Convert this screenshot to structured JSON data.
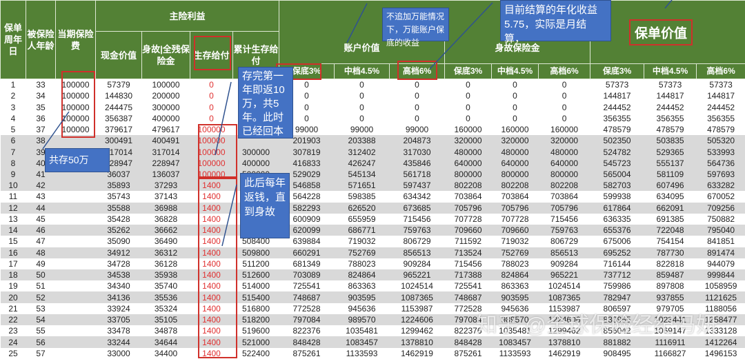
{
  "colors": {
    "header": "#538135",
    "annotation": "#4472c4",
    "highlight": "#d0302a",
    "survival_text": "#e03030",
    "row_shade": "#d9d9d9"
  },
  "header": {
    "year": "保单周年日",
    "age": "被保险人年龄",
    "premium": "当期保险费",
    "main": "主险利益",
    "cash": "现金价值",
    "death": "身故|全残保险金",
    "survival": "生存给付",
    "cum_survival": "累计生存给付",
    "account": "账户价值",
    "death_benefit": "身故保险金",
    "policy_value": "保单价值",
    "rates": [
      "保底3%",
      "中档4.5%",
      "高档6%",
      "保底3%",
      "中档4.5%",
      "高档6%",
      "保底3%",
      "中档4.5%",
      "高档6%"
    ]
  },
  "rows": [
    [
      "1",
      "33",
      "100000",
      "57379",
      "100000",
      "0",
      "",
      "0",
      "0",
      "0",
      "0",
      "0",
      "0",
      "57373",
      "57373",
      "57373"
    ],
    [
      "2",
      "34",
      "100000",
      "144830",
      "200000",
      "0",
      "",
      "0",
      "0",
      "0",
      "0",
      "0",
      "0",
      "144817",
      "144817",
      "144817"
    ],
    [
      "3",
      "35",
      "100000",
      "244475",
      "300000",
      "0",
      "",
      "0",
      "0",
      "0",
      "0",
      "0",
      "0",
      "244452",
      "244452",
      "244452"
    ],
    [
      "4",
      "36",
      "100000",
      "356387",
      "400000",
      "0",
      "",
      "0",
      "0",
      "0",
      "0",
      "0",
      "0",
      "356355",
      "356355",
      "356355"
    ],
    [
      "5",
      "37",
      "100000",
      "379617",
      "479617",
      "100000",
      "",
      "99000",
      "99000",
      "99000",
      "160000",
      "160000",
      "160000",
      "478579",
      "478579",
      "478579"
    ],
    [
      "6",
      "38",
      "",
      "300491",
      "400491",
      "100000",
      "",
      "201903",
      "203388",
      "204873",
      "320000",
      "320000",
      "320000",
      "502350",
      "503835",
      "505320"
    ],
    [
      "7",
      "39",
      "",
      "217014",
      "317014",
      "100000",
      "300000",
      "307819",
      "312402",
      "317030",
      "480000",
      "480000",
      "480000",
      "524782",
      "529365",
      "533993"
    ],
    [
      "8",
      "40",
      "",
      "128947",
      "228947",
      "100000",
      "400000",
      "416833",
      "426247",
      "435846",
      "640000",
      "640000",
      "640000",
      "545723",
      "555137",
      "564736"
    ],
    [
      "9",
      "41",
      "",
      "36037",
      "136037",
      "100000",
      "500000",
      "529029",
      "545134",
      "561718",
      "800000",
      "800000",
      "800000",
      "565004",
      "581109",
      "597693"
    ],
    [
      "10",
      "42",
      "",
      "35893",
      "37293",
      "1400",
      "",
      "546858",
      "571651",
      "597437",
      "802208",
      "802208",
      "802208",
      "582703",
      "607496",
      "633282"
    ],
    [
      "11",
      "43",
      "",
      "35743",
      "37143",
      "1400",
      "",
      "564228",
      "598385",
      "634342",
      "703864",
      "703864",
      "703864",
      "599938",
      "634095",
      "670052"
    ],
    [
      "12",
      "44",
      "",
      "35588",
      "36988",
      "1400",
      "",
      "582293",
      "626520",
      "673685",
      "705796",
      "705796",
      "705796",
      "617864",
      "662091",
      "709256"
    ],
    [
      "13",
      "45",
      "",
      "35428",
      "36828",
      "1400",
      "",
      "600909",
      "655959",
      "715456",
      "707728",
      "707728",
      "715456",
      "636335",
      "691385",
      "750882"
    ],
    [
      "14",
      "46",
      "",
      "35262",
      "36662",
      "1400",
      "",
      "620099",
      "686771",
      "759763",
      "709660",
      "709660",
      "759763",
      "655376",
      "722048",
      "795040"
    ],
    [
      "15",
      "47",
      "",
      "35090",
      "36490",
      "1400",
      "508400",
      "639884",
      "719032",
      "806729",
      "711592",
      "719032",
      "806729",
      "675006",
      "754154",
      "841851"
    ],
    [
      "16",
      "48",
      "",
      "34912",
      "36312",
      "1400",
      "509800",
      "660291",
      "752769",
      "856513",
      "713524",
      "752769",
      "856513",
      "695252",
      "787730",
      "891474"
    ],
    [
      "17",
      "49",
      "",
      "34728",
      "36128",
      "1400",
      "511200",
      "681349",
      "788023",
      "909284",
      "715456",
      "788023",
      "909284",
      "716144",
      "822818",
      "944079"
    ],
    [
      "18",
      "50",
      "",
      "34538",
      "35938",
      "1400",
      "512600",
      "703089",
      "824864",
      "965221",
      "717388",
      "824864",
      "965221",
      "737712",
      "859487",
      "999844"
    ],
    [
      "19",
      "51",
      "",
      "34340",
      "35740",
      "1400",
      "514000",
      "725541",
      "863363",
      "1024514",
      "725541",
      "863363",
      "1024514",
      "759986",
      "897808",
      "1058959"
    ],
    [
      "20",
      "52",
      "",
      "34136",
      "35536",
      "1400",
      "515400",
      "748687",
      "903595",
      "1087365",
      "748687",
      "903595",
      "1087365",
      "782947",
      "937855",
      "1121625"
    ],
    [
      "21",
      "53",
      "",
      "33924",
      "35324",
      "1400",
      "516800",
      "772528",
      "945636",
      "1153987",
      "772528",
      "945636",
      "1153987",
      "806597",
      "979705",
      "1188056"
    ],
    [
      "22",
      "54",
      "",
      "33705",
      "35105",
      "1400",
      "518200",
      "797084",
      "989570",
      "1224606",
      "797084",
      "989570",
      "1224606",
      "830955",
      "1023441",
      "1258477"
    ],
    [
      "23",
      "55",
      "",
      "33478",
      "34878",
      "1400",
      "519600",
      "822376",
      "1035481",
      "1299462",
      "822376",
      "1035481",
      "1299462",
      "856042",
      "1069147",
      "1333128"
    ],
    [
      "24",
      "56",
      "",
      "33244",
      "34644",
      "1400",
      "521000",
      "848428",
      "1083457",
      "1378810",
      "848428",
      "1083457",
      "1378810",
      "881882",
      "1116911",
      "1412264"
    ],
    [
      "25",
      "57",
      "",
      "33000",
      "34400",
      "1400",
      "522400",
      "875261",
      "1133593",
      "1462919",
      "875261",
      "1133593",
      "1462919",
      "908495",
      "1166827",
      "1496153"
    ]
  ],
  "annotations": {
    "return_first": "存完第一年即返10万，共5年。此时已经回本",
    "total_saved": "共存50万",
    "annual_return": "此后每年返钱，直到身故",
    "guaranteed_note": "不追加万能情况下，万能账户保底的收益",
    "settlement_note": "目前结算的年化收益5.75，实际是月结算，"
  },
  "watermark": "知乎 @全球保险经纪冯妍"
}
